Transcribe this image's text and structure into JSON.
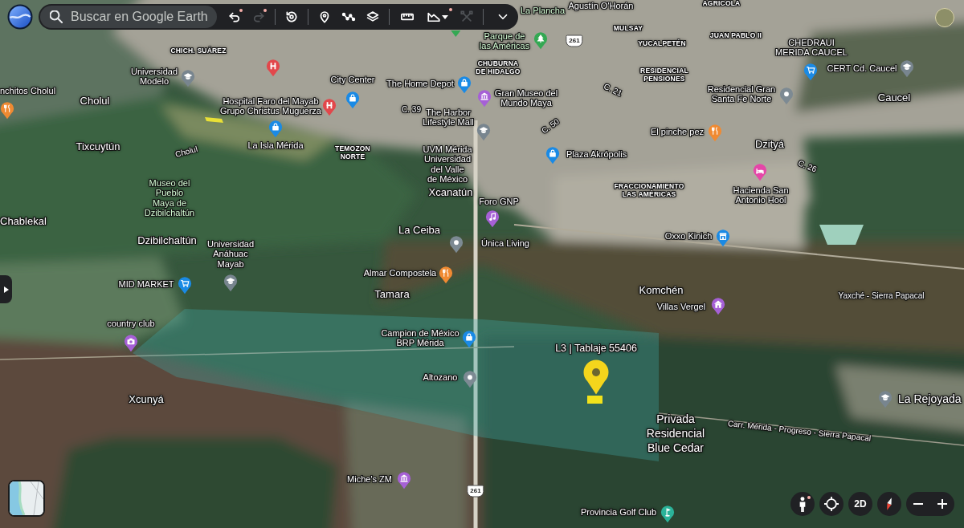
{
  "toolbar": {
    "search": {
      "placeholder": "Buscar en Google Earth"
    },
    "groups": [
      [
        {
          "kind": "undo",
          "disabled": false,
          "dot": true,
          "dropdown": false
        },
        {
          "kind": "redo",
          "disabled": true,
          "dot": true,
          "dropdown": false
        }
      ],
      [
        {
          "kind": "history",
          "disabled": false,
          "dot": false,
          "dropdown": false
        }
      ],
      [
        {
          "kind": "placemark",
          "disabled": false,
          "dot": false,
          "dropdown": false
        },
        {
          "kind": "path",
          "disabled": false,
          "dot": false,
          "dropdown": false
        },
        {
          "kind": "layers",
          "disabled": false,
          "dot": false,
          "dropdown": false
        }
      ],
      [
        {
          "kind": "ruler",
          "disabled": false,
          "dot": false,
          "dropdown": false
        },
        {
          "kind": "terrain",
          "disabled": false,
          "dot": true,
          "dropdown": true
        },
        {
          "kind": "tools",
          "disabled": true,
          "dot": false,
          "dropdown": false
        }
      ],
      [
        {
          "kind": "more",
          "disabled": false,
          "dot": false,
          "dropdown": false
        }
      ]
    ]
  },
  "map": {
    "park_labels": [
      "La Plancha",
      "Parque de las Américas",
      "Museo del Pueblo Maya de Dzibilchaltún"
    ],
    "neighborhood_labels": [
      "AGRICOLA",
      "MULSAY",
      "JUAN PABLO II",
      "YUCALPETÉN",
      "CHICH. SUÁREZ",
      "CHUBURNA DE HIDALGO",
      "RESIDENCIAL PENSIONES",
      "TEMOZON NORTE",
      "FRACCIONAMIENTO LAS AMÉRICAS"
    ],
    "town_labels": [
      "Cholul",
      "Caucel",
      "Tixcuytún",
      "Dzityá",
      "Xcanatún",
      "Chablekal",
      "La Ceiba",
      "Dzibilchaltún",
      "Tamara",
      "Komchén",
      "Xcunyá"
    ],
    "place_labels": [
      "Agustín O'Horán",
      "CHEDRAUI MERIDA CAUCEL",
      "Universidad Modelo",
      "CERT Cd. Caucel",
      "City Center",
      "The Home Depot",
      "nchitos Cholul",
      "Hospital Faro del Mayab Grupo Christus Muguerza",
      "Gran Museo del Mundo Maya",
      "Residencial Gran Santa Fe Norte",
      "The Harbor Lifestyle Mall",
      "El pinche pez",
      "La Isla Mérida",
      "UVM Mérida Universidad del Valle de México",
      "Plaza Akrópolis",
      "Foro GNP",
      "Hacienda San Antonio Hool",
      "Oxxo Kinich",
      "Universidad Anáhuac Mayab",
      "Única Living",
      "Almar Compostela",
      "MID MARKET",
      "Villas Vergel",
      "country club",
      "Campion de México BRP Mérida",
      "Altozano",
      "Miche's ZM",
      "Provincia Golf Club"
    ],
    "area_labels": [
      "La Rejoyada",
      "Privada Residencial Blue Cedar"
    ],
    "road_labels": [
      "C. 21",
      "C. 39",
      "C. 50",
      "Cholul",
      "C. 26",
      "Yaxché - Sierra Papacal",
      "Carr. Mérida - Progreso - Sierra Papacal"
    ],
    "placemark": {
      "label": "L3 | Tablaje 55406"
    },
    "pins": [
      {
        "kind": "clipped",
        "color": "#34a853"
      },
      {
        "kind": "hospital",
        "color": "#e2474b"
      },
      {
        "kind": "education",
        "color": "#78858f"
      },
      {
        "kind": "shopping",
        "color": "#1a8ae5"
      },
      {
        "kind": "shopping",
        "color": "#1a8ae5"
      },
      {
        "kind": "museum",
        "color": "#a660d6"
      },
      {
        "kind": "park",
        "color": "#34a853"
      },
      {
        "kind": "cart",
        "color": "#1a8ae5"
      },
      {
        "kind": "education",
        "color": "#78858f"
      },
      {
        "kind": "restaurant",
        "color": "#f08a32"
      },
      {
        "kind": "hospital",
        "color": "#e2474b"
      },
      {
        "kind": "generic",
        "color": "#7d8a93"
      },
      {
        "kind": "shopping",
        "color": "#1a8ae5"
      },
      {
        "kind": "education",
        "color": "#78858f"
      },
      {
        "kind": "restaurant",
        "color": "#f08a32"
      },
      {
        "kind": "shopping",
        "color": "#1a8ae5"
      },
      {
        "kind": "hotel",
        "color": "#e546a8"
      },
      {
        "kind": "music",
        "color": "#a660d6"
      },
      {
        "kind": "generic",
        "color": "#7d8a93"
      },
      {
        "kind": "store",
        "color": "#1a8ae5"
      },
      {
        "kind": "restaurant",
        "color": "#f08a32"
      },
      {
        "kind": "cart",
        "color": "#1a8ae5"
      },
      {
        "kind": "education",
        "color": "#78858f"
      },
      {
        "kind": "house",
        "color": "#a660d6"
      },
      {
        "kind": "camera",
        "color": "#a660d6"
      },
      {
        "kind": "shopping",
        "color": "#1a8ae5"
      },
      {
        "kind": "generic",
        "color": "#7d8a93"
      },
      {
        "kind": "education",
        "color": "#78858f"
      },
      {
        "kind": "museum",
        "color": "#a660d6"
      },
      {
        "kind": "golf",
        "color": "#2bb39a"
      }
    ],
    "route_shields": [
      "261",
      "261"
    ]
  },
  "map_controls": {
    "buttons": [
      {
        "kind": "street-view",
        "dot": true
      },
      {
        "kind": "locate",
        "dot": false
      },
      {
        "kind": "view-mode",
        "label": "2D",
        "dot": false
      },
      {
        "kind": "compass",
        "dot": false
      }
    ],
    "zoom": [
      {
        "kind": "zoom-out"
      },
      {
        "kind": "zoom-in"
      }
    ]
  }
}
